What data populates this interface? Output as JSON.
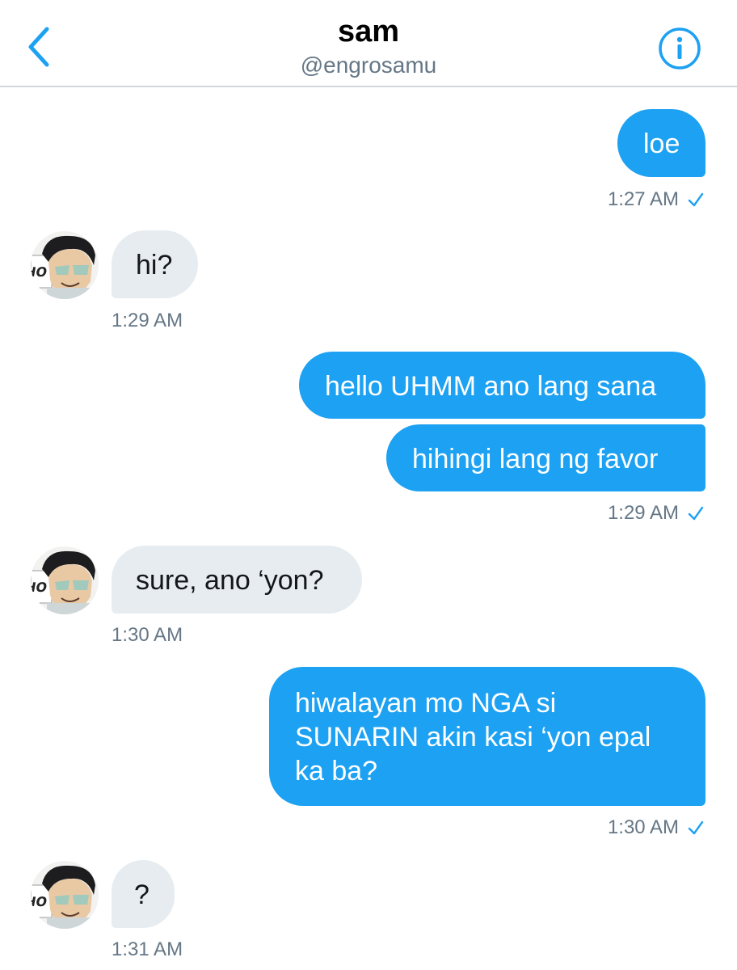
{
  "header": {
    "name": "sam",
    "handle": "@engrosamu",
    "back_icon": "chevron-left-icon",
    "info_icon": "info-icon"
  },
  "colors": {
    "accent": "#1da1f2",
    "incoming_bubble": "#e6ecf0",
    "meta_text": "#657786",
    "divider": "#d3d6d9"
  },
  "messages": [
    {
      "direction": "outgoing",
      "text": "loe",
      "time": "1:27 AM",
      "read_icon": "check-icon"
    },
    {
      "direction": "incoming",
      "text": "hi?",
      "time": "1:29 AM",
      "avatar_icon": "avatar"
    },
    {
      "direction": "outgoing",
      "text": "hello UHMM ano lang sana"
    },
    {
      "direction": "outgoing",
      "text": "hihingi lang ng favor",
      "time": "1:29 AM",
      "read_icon": "check-icon"
    },
    {
      "direction": "incoming",
      "text": "sure, ano ‘yon?",
      "time": "1:30 AM",
      "avatar_icon": "avatar"
    },
    {
      "direction": "outgoing",
      "text_lines": [
        "hiwalayan mo NGA si",
        "SUNARIN akin kasi ‘yon epal",
        "ka ba?"
      ],
      "time": "1:30 AM",
      "read_icon": "check-icon"
    },
    {
      "direction": "incoming",
      "text": "?",
      "time": "1:31 AM",
      "avatar_icon": "avatar"
    }
  ]
}
